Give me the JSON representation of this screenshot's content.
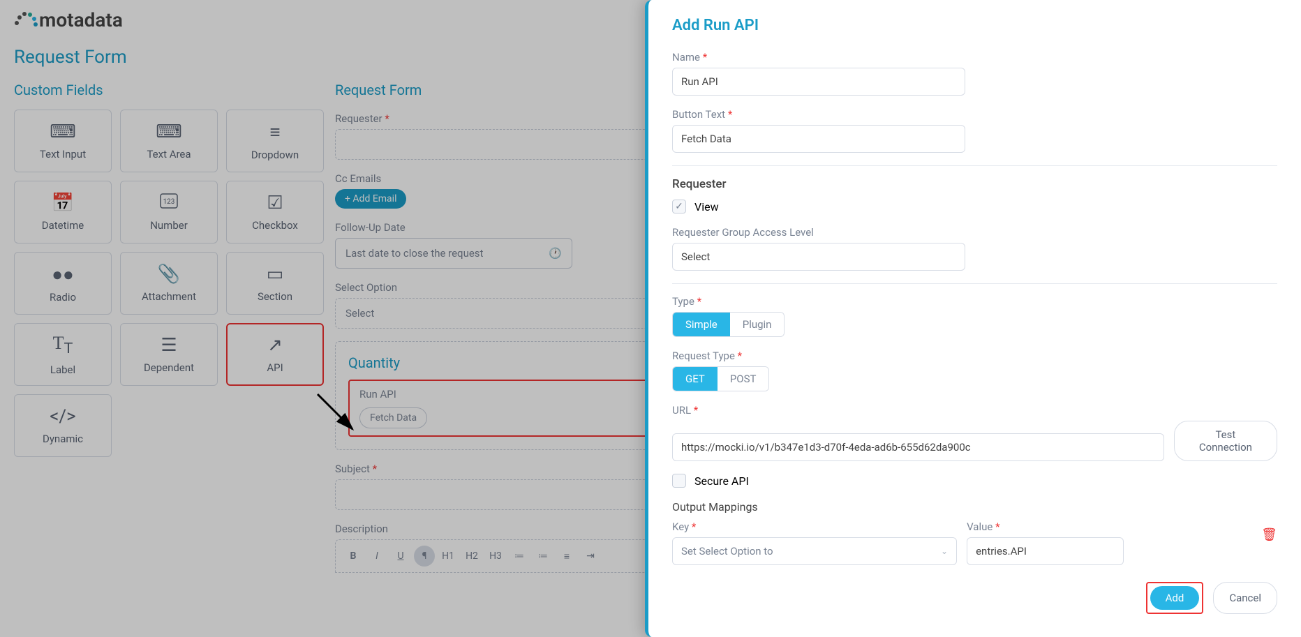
{
  "logo": "motadata",
  "page_title": "Request Form",
  "sidebar": {
    "header": "Custom Fields",
    "fields": [
      {
        "icon": "text-input",
        "label": "Text Input"
      },
      {
        "icon": "text-area",
        "label": "Text Area"
      },
      {
        "icon": "dropdown",
        "label": "Dropdown"
      },
      {
        "icon": "datetime",
        "label": "Datetime"
      },
      {
        "icon": "number",
        "label": "Number"
      },
      {
        "icon": "checkbox",
        "label": "Checkbox"
      },
      {
        "icon": "radio",
        "label": "Radio"
      },
      {
        "icon": "attachment",
        "label": "Attachment"
      },
      {
        "icon": "section",
        "label": "Section"
      },
      {
        "icon": "label",
        "label": "Label"
      },
      {
        "icon": "dependent",
        "label": "Dependent"
      },
      {
        "icon": "api",
        "label": "API"
      },
      {
        "icon": "dynamic",
        "label": "Dynamic"
      }
    ]
  },
  "form": {
    "header": "Request Form",
    "requester_label": "Requester",
    "cc_label": "Cc Emails",
    "add_email": "+ Add Email",
    "followup_label": "Follow-Up Date",
    "followup_placeholder": "Last date to close the request",
    "select_option_label": "Select Option",
    "select_option_placeholder": "Select",
    "quantity_title": "Quantity",
    "run_api_label": "Run API",
    "fetch_btn": "Fetch Data",
    "subject_label": "Subject",
    "description_label": "Description"
  },
  "panel": {
    "title": "Add Run API",
    "name_label": "Name",
    "name_value": "Run API",
    "button_text_label": "Button Text",
    "button_text_value": "Fetch Data",
    "requester_header": "Requester",
    "view_label": "View",
    "group_access_label": "Requester Group Access Level",
    "group_access_placeholder": "Select",
    "type_label": "Type",
    "type_simple": "Simple",
    "type_plugin": "Plugin",
    "request_type_label": "Request Type",
    "request_type_get": "GET",
    "request_type_post": "POST",
    "url_label": "URL",
    "url_value": "https://mocki.io/v1/b347e1d3-d70f-4eda-ad6b-655d62da900c",
    "test_connection": "Test Connection",
    "secure_api_label": "Secure API",
    "output_mappings": "Output Mappings",
    "key_label": "Key",
    "key_value": "Set Select Option to",
    "value_label": "Value",
    "value_value": "entries.API",
    "add_btn": "Add",
    "cancel_btn": "Cancel"
  },
  "rte": {
    "h1": "H1",
    "h2": "H2",
    "h3": "H3"
  }
}
